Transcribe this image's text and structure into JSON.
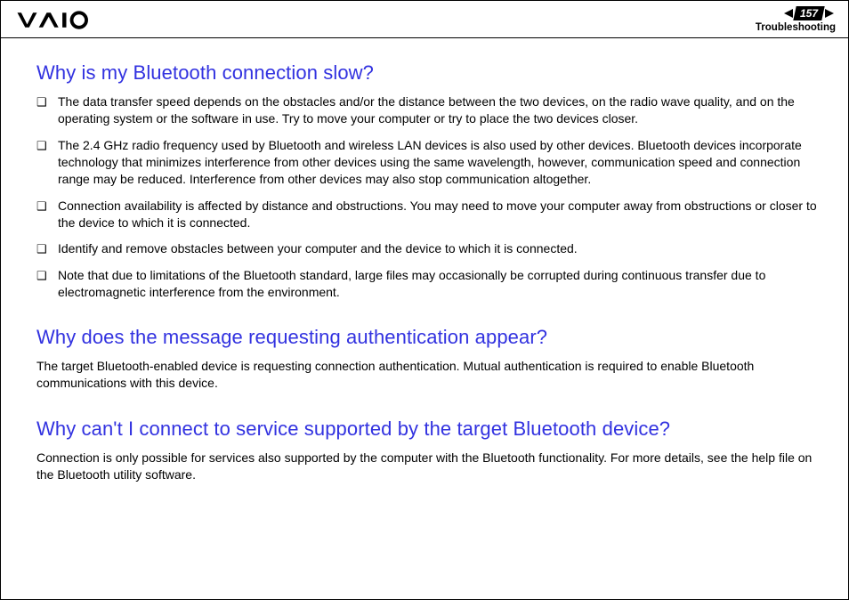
{
  "header": {
    "page_number": "157",
    "section": "Troubleshooting"
  },
  "sections": [
    {
      "title": "Why is my Bluetooth connection slow?",
      "bullets": [
        "The data transfer speed depends on the obstacles and/or the distance between the two devices, on the radio wave quality, and on the operating system or the software in use. Try to move your computer or try to place the two devices closer.",
        "The 2.4 GHz radio frequency used by Bluetooth and wireless LAN devices is also used by other devices. Bluetooth devices incorporate technology that minimizes interference from other devices using the same wavelength, however, communication speed and connection range may be reduced. Interference from other devices may also stop communication altogether.",
        "Connection availability is affected by distance and obstructions. You may need to move your computer away from obstructions or closer to the device to which it is connected.",
        "Identify and remove obstacles between your computer and the device to which it is connected.",
        "Note that due to limitations of the Bluetooth standard, large files may occasionally be corrupted during continuous transfer due to electromagnetic interference from the environment."
      ]
    },
    {
      "title": "Why does the message requesting authentication appear?",
      "body": "The target Bluetooth-enabled device is requesting connection authentication. Mutual authentication is required to enable Bluetooth communications with this device."
    },
    {
      "title": "Why can't I connect to service supported by the target Bluetooth device?",
      "body": "Connection is only possible for services also supported by the computer with the Bluetooth functionality. For more details, see the help file on the Bluetooth utility software."
    }
  ]
}
